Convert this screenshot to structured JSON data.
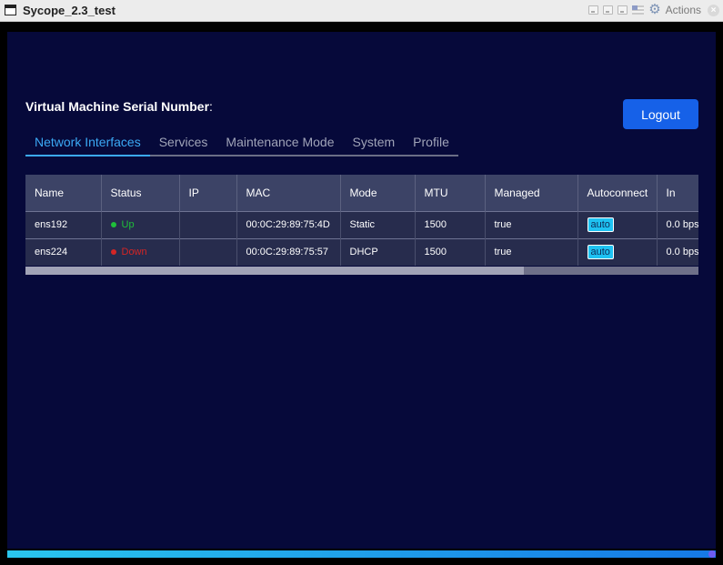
{
  "window": {
    "title": "Sycope_2.3_test",
    "actions_label": "Actions"
  },
  "header": {
    "serial_label": "Virtual Machine Serial Number",
    "serial_colon": ":",
    "logout_label": "Logout"
  },
  "tabs": [
    {
      "label": "Network Interfaces",
      "active": true
    },
    {
      "label": "Services",
      "active": false
    },
    {
      "label": "Maintenance Mode",
      "active": false
    },
    {
      "label": "System",
      "active": false
    },
    {
      "label": "Profile",
      "active": false
    }
  ],
  "table": {
    "columns": [
      "Name",
      "Status",
      "IP",
      "MAC",
      "Mode",
      "MTU",
      "Managed",
      "Autoconnect",
      "In"
    ],
    "rows": [
      {
        "name": "ens192",
        "status": "Up",
        "status_color": "#1fbf3a",
        "ip": "",
        "mac": "00:0C:29:89:75:4D",
        "mode": "Static",
        "mtu": "1500",
        "managed": "true",
        "autoconnect": "auto",
        "in": "0.0 bps"
      },
      {
        "name": "ens224",
        "status": "Down",
        "status_color": "#d42525",
        "ip": "",
        "mac": "00:0C:29:89:75:57",
        "mode": "DHCP",
        "mtu": "1500",
        "managed": "true",
        "autoconnect": "auto",
        "in": "0.0 bps"
      }
    ]
  },
  "scrollbar": {
    "thumb_fraction": 0.74
  },
  "progress": {
    "value_fraction": 1.0
  },
  "colors": {
    "accent": "#3ba9f5",
    "logout": "#1661e8",
    "background": "#06093a"
  },
  "icons": [
    "app-icon",
    "minimize-icon",
    "restore-icon",
    "maximize-icon",
    "flag-icon",
    "gear-icon",
    "close-icon",
    "status-dot-icon"
  ]
}
